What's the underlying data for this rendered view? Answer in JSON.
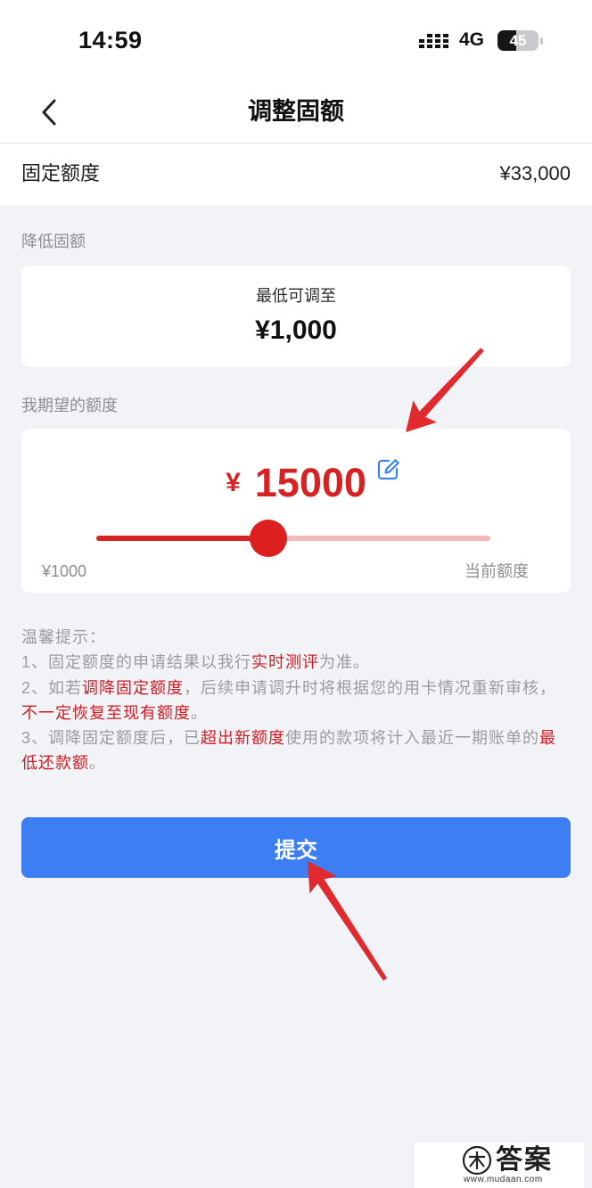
{
  "status_bar": {
    "time": "14:59",
    "network": "4G",
    "battery": "45",
    "signal_icon": "signal-icon"
  },
  "nav": {
    "title": "调整固额",
    "back_icon": "chevron-left-icon"
  },
  "fixed_limit": {
    "label": "固定额度",
    "value": "¥33,000"
  },
  "lower_limit": {
    "section_label": "降低固额",
    "caption": "最低可调至",
    "min_value": "¥1,000"
  },
  "desired_limit": {
    "section_label": "我期望的额度",
    "currency": "¥",
    "amount": "15000",
    "edit_icon": "edit-icon",
    "slider": {
      "min": 1000,
      "max": 33000,
      "value": 15000,
      "min_label": "¥1000",
      "max_label": "当前额度"
    }
  },
  "tips": {
    "heading": "温馨提示：",
    "items": [
      [
        {
          "text": "1、固定额度的申请结果以我行",
          "emphasis": false
        },
        {
          "text": "实时测评",
          "emphasis": true
        },
        {
          "text": "为准。",
          "emphasis": false
        }
      ],
      [
        {
          "text": "2、如若",
          "emphasis": false
        },
        {
          "text": "调降固定额度",
          "emphasis": true
        },
        {
          "text": "，后续申请调升时将根据您的用卡情况重新审核，",
          "emphasis": false
        },
        {
          "text": "不一定恢复至现有额度",
          "emphasis": true
        },
        {
          "text": "。",
          "emphasis": false
        }
      ],
      [
        {
          "text": "3、调降固定额度后，已",
          "emphasis": false
        },
        {
          "text": "超出新额度",
          "emphasis": true
        },
        {
          "text": "使用的款项将计入最近一期账单的",
          "emphasis": false
        },
        {
          "text": "最低还款额",
          "emphasis": true
        },
        {
          "text": "。",
          "emphasis": false
        }
      ]
    ]
  },
  "submit": {
    "label": "提交"
  },
  "watermark": {
    "title": "答案",
    "url": "www.mudaan.com",
    "logo_icon": "mudaan-logo-icon"
  },
  "colors": {
    "accent_red": "#d62222",
    "primary_blue": "#3d7ef2",
    "page_background": "#f2f3f7",
    "annotation_red": "#e02a2f"
  }
}
